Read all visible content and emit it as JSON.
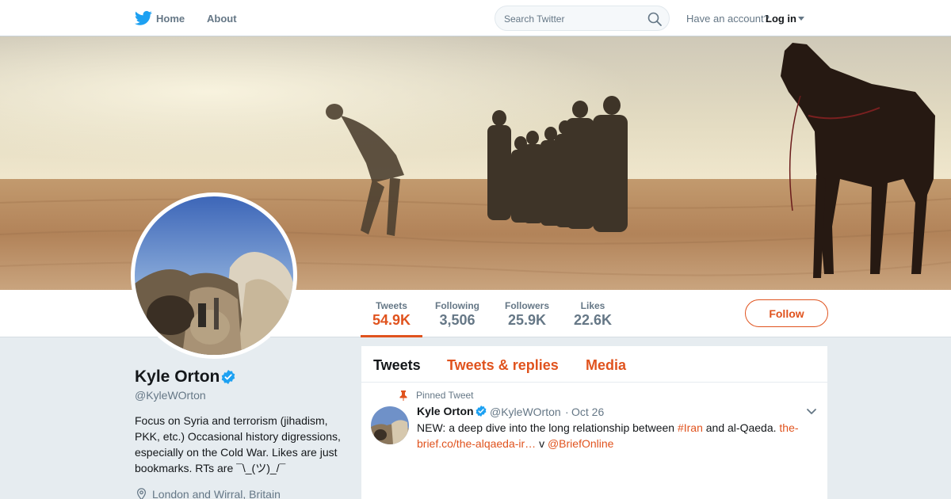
{
  "nav": {
    "home": "Home",
    "about": "About",
    "search_placeholder": "Search Twitter",
    "account_prompt": "Have an account?",
    "login": "Log in"
  },
  "profile": {
    "name": "Kyle Orton",
    "handle": "@KyleWOrton",
    "bio": "Focus on Syria and terrorism (jihadism, PKK, etc.) Occasional history digressions, especially on the Cold War. Likes are just bookmarks. RTs are ¯\\_(ツ)_/¯",
    "location": "London and Wirral, Britain"
  },
  "stats": [
    {
      "label": "Tweets",
      "value": "54.9K"
    },
    {
      "label": "Following",
      "value": "3,506"
    },
    {
      "label": "Followers",
      "value": "25.9K"
    },
    {
      "label": "Likes",
      "value": "22.6K"
    }
  ],
  "follow_button": "Follow",
  "tabs": [
    "Tweets",
    "Tweets & replies",
    "Media"
  ],
  "tweet": {
    "pinned_label": "Pinned Tweet",
    "name": "Kyle Orton",
    "handle": "@KyleWOrton",
    "separator": "·",
    "time": "Oct 26",
    "text_1": "NEW: a deep dive into the long relationship between ",
    "hashtag": "#Iran",
    "text_2": " and al-Qaeda. ",
    "link": "the-brief.co/the-alqaeda-ir…",
    "text_3": " v ",
    "mention": "@BriefOnline"
  },
  "colors": {
    "accent": "#e0531e",
    "twitter_blue": "#1da1f2",
    "background": "#e6ecf0",
    "muted": "#657786"
  },
  "icons": [
    "twitter-bird-icon",
    "search-icon",
    "verified-badge-icon",
    "location-pin-icon",
    "pin-icon",
    "chevron-down-icon"
  ]
}
